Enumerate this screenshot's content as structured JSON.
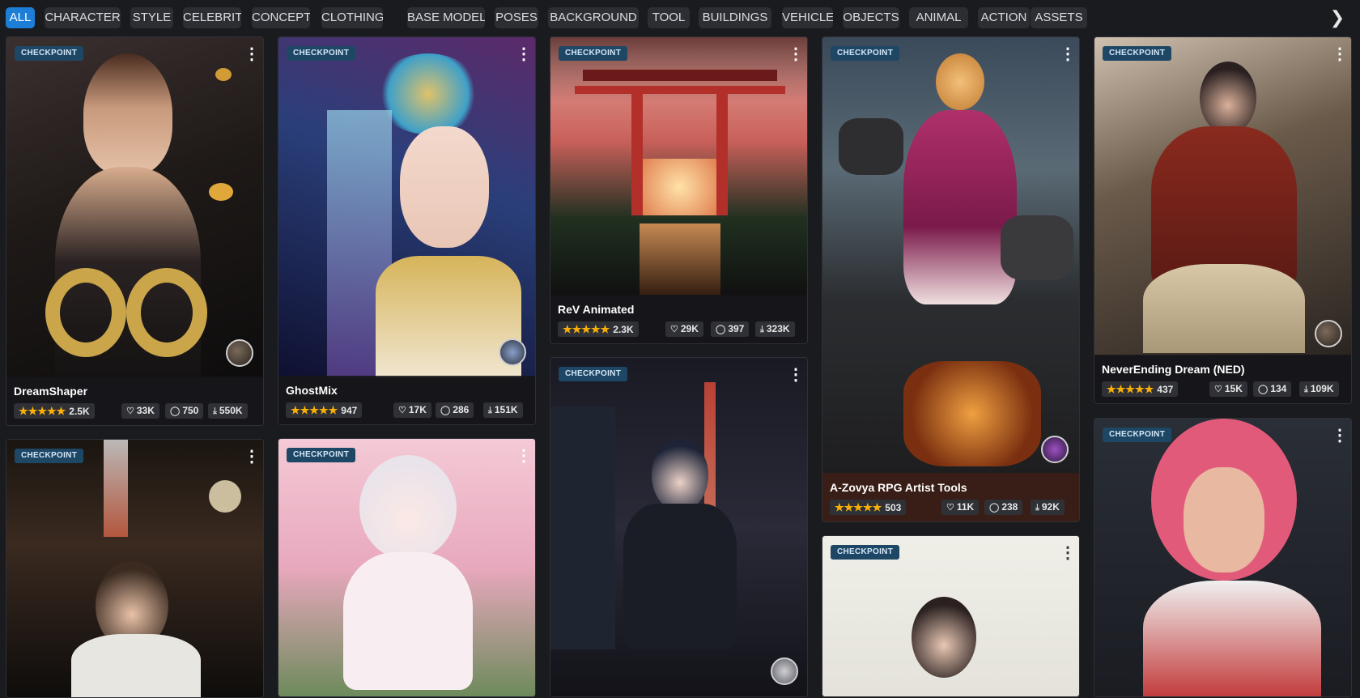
{
  "categories": [
    {
      "label": "ALL",
      "active": true
    },
    {
      "label": "CHARACTER"
    },
    {
      "label": "STYLE"
    },
    {
      "label": "CELEBRITY"
    },
    {
      "label": "CONCEPT"
    },
    {
      "label": "CLOTHING"
    },
    {
      "label": "BASE MODEL"
    },
    {
      "label": "POSES"
    },
    {
      "label": "BACKGROUND"
    },
    {
      "label": "TOOL"
    },
    {
      "label": "BUILDINGS"
    },
    {
      "label": "VEHICLE"
    },
    {
      "label": "OBJECTS"
    },
    {
      "label": "ANIMAL"
    },
    {
      "label": "ACTION"
    },
    {
      "label": "ASSETS"
    }
  ],
  "next_icon": "chevron-right-icon",
  "cards": [
    {
      "badge": "CHECKPOINT",
      "title": "DreamShaper",
      "rating": "2.5K",
      "likes": "33K",
      "comments": "750",
      "downloads": "550K"
    },
    {
      "badge": "CHECKPOINT",
      "title": "GhostMix",
      "rating": "947",
      "likes": "17K",
      "comments": "286",
      "downloads": "151K"
    },
    {
      "badge": "CHECKPOINT",
      "title": "ReV Animated",
      "rating": "2.3K",
      "likes": "29K",
      "comments": "397",
      "downloads": "323K"
    },
    {
      "badge": "CHECKPOINT",
      "title": "A-Zovya RPG Artist Tools",
      "rating": "503",
      "likes": "11K",
      "comments": "238",
      "downloads": "92K"
    },
    {
      "badge": "CHECKPOINT",
      "title": "NeverEnding Dream (NED)",
      "rating": "437",
      "likes": "15K",
      "comments": "134",
      "downloads": "109K"
    },
    {
      "badge": "CHECKPOINT"
    },
    {
      "badge": "CHECKPOINT"
    },
    {
      "badge": "CHECKPOINT"
    },
    {
      "badge": "CHECKPOINT"
    },
    {
      "badge": "CHECKPOINT"
    }
  ],
  "icons": {
    "star": "★",
    "heart": "♡",
    "comment": "◯",
    "download": "⤓",
    "menu": "⋮"
  }
}
